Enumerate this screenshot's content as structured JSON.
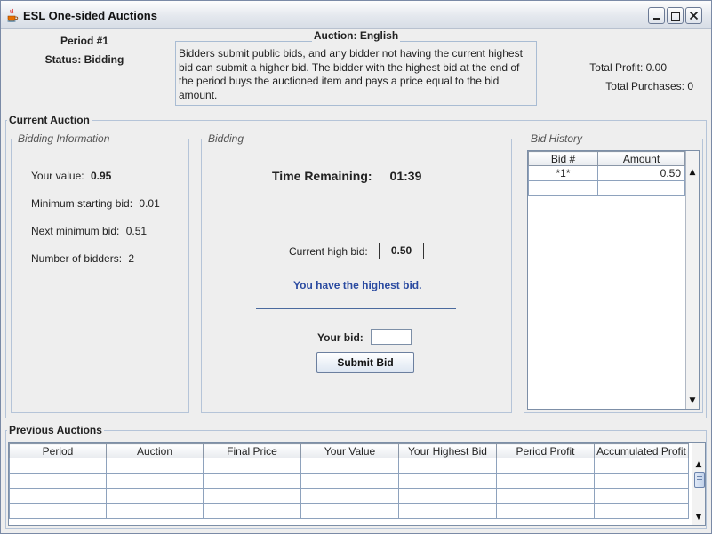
{
  "window": {
    "title": "ESL One-sided Auctions"
  },
  "header": {
    "period": "Period #1",
    "status": "Status: Bidding",
    "auction_title": "Auction: English",
    "description": "Bidders submit public bids, and any bidder not having the current highest bid can submit a higher bid. The bidder with the highest bid at the end of the period buys the auctioned item and pays a price equal to the bid amount.",
    "total_profit": "Total Profit: 0.00",
    "total_purchases": "Total Purchases: 0"
  },
  "current_auction": {
    "label": "Current Auction",
    "bidding_info": {
      "label": "Bidding Information",
      "your_value_label": "Your value:",
      "your_value": "0.95",
      "min_start_label": "Minimum starting bid:",
      "min_start": "0.01",
      "next_min_label": "Next minimum bid:",
      "next_min": "0.51",
      "num_bidders_label": "Number of bidders:",
      "num_bidders": "2"
    },
    "bidding": {
      "label": "Bidding",
      "time_label": "Time Remaining:",
      "time_value": "01:39",
      "current_high_label": "Current high bid:",
      "current_high_value": "0.50",
      "highest_msg": "You have the highest bid.",
      "your_bid_label": "Your bid:",
      "your_bid_value": "",
      "submit_label": "Submit Bid"
    },
    "bid_history": {
      "label": "Bid History",
      "columns": [
        "Bid #",
        "Amount"
      ],
      "rows": [
        [
          "*1*",
          "0.50"
        ]
      ]
    }
  },
  "previous_auctions": {
    "label": "Previous Auctions",
    "columns": [
      "Period",
      "Auction",
      "Final Price",
      "Your Value",
      "Your Highest Bid",
      "Period Profit",
      "Accumulated Profit"
    ]
  },
  "colors": {
    "highest_msg": "#2a4aa0",
    "window_bg": "#eeeeee"
  }
}
